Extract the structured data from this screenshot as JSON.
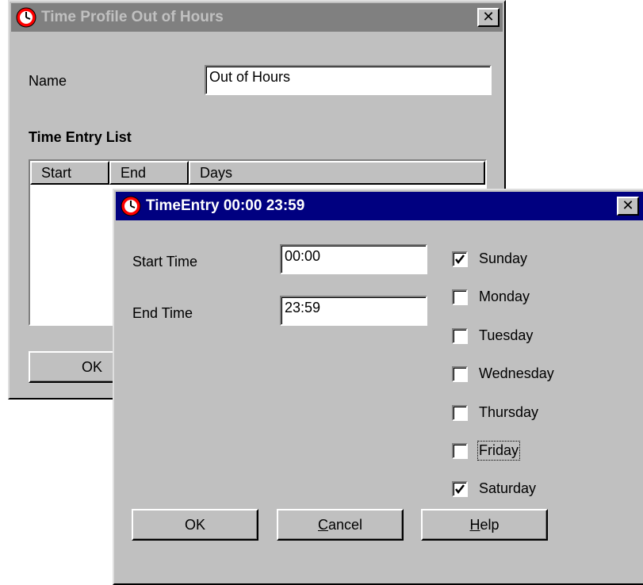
{
  "profile_window": {
    "title": "Time Profile Out of Hours",
    "name_label": "Name",
    "name_value": "Out of Hours",
    "list_heading": "Time Entry List",
    "columns": [
      "Start",
      "End",
      "Days"
    ],
    "ok_label": "OK"
  },
  "entry_window": {
    "title": "TimeEntry 00:00 23:59",
    "start_label": "Start Time",
    "start_value": "00:00",
    "end_label": "End Time",
    "end_value": "23:59",
    "days": [
      {
        "label": "Sunday",
        "checked": true
      },
      {
        "label": "Monday",
        "checked": false
      },
      {
        "label": "Tuesday",
        "checked": false
      },
      {
        "label": "Wednesday",
        "checked": false
      },
      {
        "label": "Thursday",
        "checked": false
      },
      {
        "label": "Friday",
        "checked": false
      },
      {
        "label": "Saturday",
        "checked": true
      }
    ],
    "buttons": {
      "ok": "OK",
      "cancel_underlined": "C",
      "cancel_rest": "ancel",
      "help_underlined": "H",
      "help_rest": "elp"
    }
  },
  "icons": {
    "window_icon": "red-clock-icon",
    "close": "close-icon",
    "check": "checkmark-icon"
  },
  "colors": {
    "active_title": "#000080",
    "inactive_title": "#808080",
    "face": "#c0c0c0"
  }
}
